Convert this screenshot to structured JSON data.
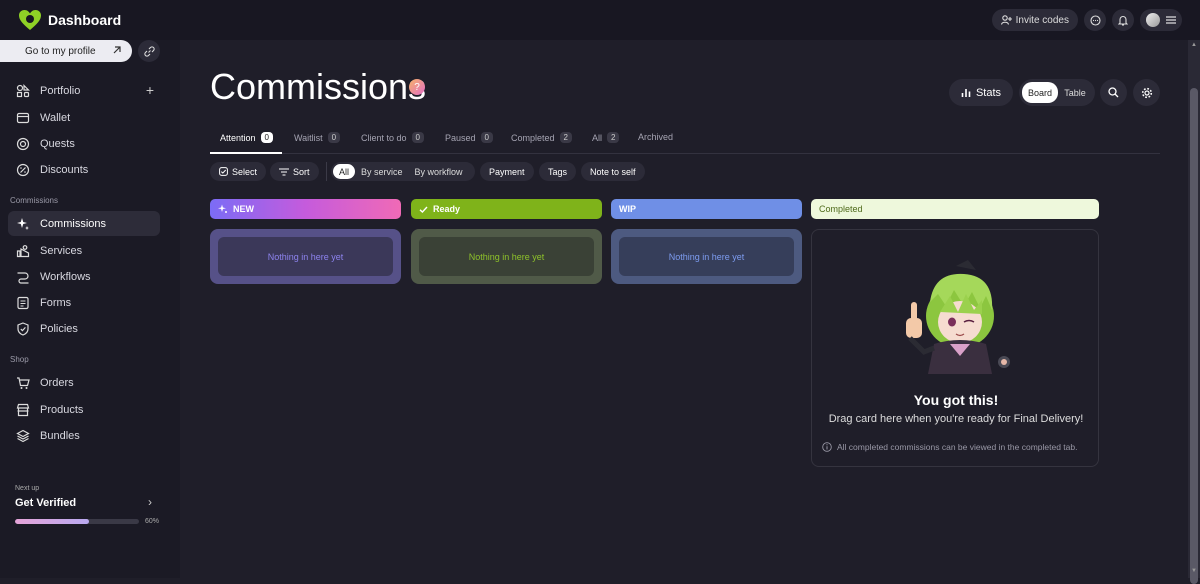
{
  "app": {
    "title": "Dashboard"
  },
  "topbar": {
    "invite_label": "Invite codes"
  },
  "sidebar": {
    "profile_label": "Go to my profile",
    "items": [
      {
        "label": "Portfolio",
        "icon": "portfolio-icon"
      },
      {
        "label": "Wallet",
        "icon": "wallet-icon"
      },
      {
        "label": "Quests",
        "icon": "quests-icon"
      },
      {
        "label": "Discounts",
        "icon": "discount-icon"
      }
    ],
    "commissions_section": "Commissions",
    "commission_items": [
      {
        "label": "Commissions",
        "icon": "sparkle-icon"
      },
      {
        "label": "Services",
        "icon": "services-icon"
      },
      {
        "label": "Workflows",
        "icon": "workflow-icon"
      },
      {
        "label": "Forms",
        "icon": "form-icon"
      },
      {
        "label": "Policies",
        "icon": "shield-icon"
      }
    ],
    "shop_section": "Shop",
    "shop_items": [
      {
        "label": "Orders",
        "icon": "cart-icon"
      },
      {
        "label": "Products",
        "icon": "store-icon"
      },
      {
        "label": "Bundles",
        "icon": "layers-icon"
      }
    ],
    "next_up": "Next up",
    "get_verified": "Get Verified",
    "progress": 0.6,
    "progress_label": "60%"
  },
  "main": {
    "title": "Commissions",
    "help": "?",
    "stats_label": "Stats",
    "view": {
      "board": "Board",
      "table": "Table"
    },
    "tabs": [
      {
        "label": "Attention",
        "count": "0"
      },
      {
        "label": "Waitlist",
        "count": "0"
      },
      {
        "label": "Client to do",
        "count": "0"
      },
      {
        "label": "Paused",
        "count": "0"
      },
      {
        "label": "Completed",
        "count": "2"
      },
      {
        "label": "All",
        "count": "2"
      },
      {
        "label": "Archived",
        "count": ""
      }
    ],
    "filters": {
      "select": "Select",
      "sort": "Sort",
      "all": "All",
      "by_service": "By service",
      "by_workflow": "By workflow",
      "payment": "Payment",
      "tags": "Tags",
      "note": "Note to self"
    },
    "columns": [
      {
        "label": "NEW",
        "empty": "Nothing in here yet"
      },
      {
        "label": "Ready",
        "empty": "Nothing in here yet"
      },
      {
        "label": "WIP",
        "empty": "Nothing in here yet"
      },
      {
        "label": "Completed"
      }
    ],
    "completed_panel": {
      "title": "You got this!",
      "subtitle": "Drag card here when you're ready for Final Delivery!",
      "note": "All completed commissions can be viewed in the completed tab."
    }
  },
  "colors": {
    "new_gradient": [
      "#7b6cf6",
      "#c55bdc",
      "#f06ab6"
    ],
    "ready": "#7fb31a",
    "wip": "#6f8fe6",
    "completed": "#eef8dc"
  }
}
